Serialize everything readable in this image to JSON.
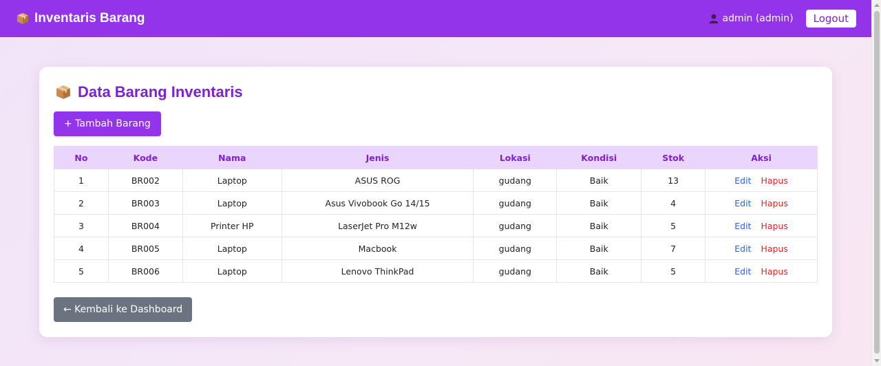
{
  "nav": {
    "brand": "Inventaris Barang",
    "user": "admin (admin)",
    "logout": "Logout"
  },
  "page": {
    "title": "Data Barang Inventaris",
    "add_button": "+ Tambah Barang",
    "back_button": "← Kembali ke Dashboard"
  },
  "table": {
    "headers": [
      "No",
      "Kode",
      "Nama",
      "Jenis",
      "Lokasi",
      "Kondisi",
      "Stok",
      "Aksi"
    ],
    "rows": [
      [
        "1",
        "BR002",
        "Laptop",
        "ASUS ROG",
        "gudang",
        "Baik",
        "13"
      ],
      [
        "2",
        "BR003",
        "Laptop",
        "Asus Vivobook Go 14/15",
        "gudang",
        "Baik",
        "4"
      ],
      [
        "3",
        "BR004",
        "Printer HP",
        "LaserJet Pro M12w",
        "gudang",
        "Baik",
        "5"
      ],
      [
        "4",
        "BR005",
        "Laptop",
        "Macbook",
        "gudang",
        "Baik",
        "7"
      ],
      [
        "5",
        "BR006",
        "Laptop",
        "Lenovo ThinkPad",
        "gudang",
        "Baik",
        "5"
      ]
    ],
    "edit_label": "Edit",
    "delete_label": "Hapus"
  },
  "icons": {
    "brand": "package-icon",
    "title": "package-icon",
    "user": "user-icon"
  },
  "colors": {
    "primary": "#9333ea",
    "title": "#7e22ce",
    "header_bg": "#ead5fd",
    "edit": "#2563eb",
    "delete": "#dc2626",
    "back_button": "#6b7280"
  }
}
